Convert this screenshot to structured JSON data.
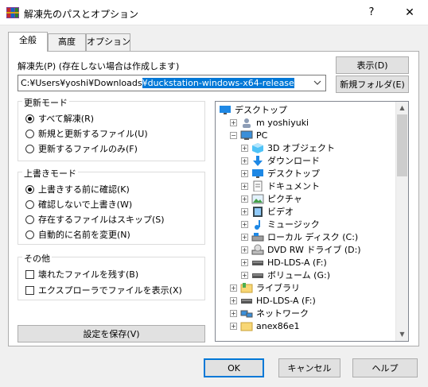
{
  "window": {
    "title": "解凍先のパスとオプション",
    "help": "?",
    "close": "✕"
  },
  "tabs": [
    "全般",
    "高度",
    "オプション"
  ],
  "dest": {
    "label": "解凍先(P) (存在しない場合は作成します)",
    "path_prefix": "C:¥Users¥yoshi¥Downloads",
    "path_selected": "¥duckstation-windows-x64-release"
  },
  "buttons": {
    "show": "表示(D)",
    "new_folder": "新規フォルダ(E)",
    "save": "設定を保存(V)",
    "ok": "OK",
    "cancel": "キャンセル",
    "help": "ヘルプ"
  },
  "update_mode": {
    "title": "更新モード",
    "options": [
      "すべて解凍(R)",
      "新規と更新するファイル(U)",
      "更新するファイルのみ(F)"
    ],
    "selected": 0
  },
  "overwrite_mode": {
    "title": "上書きモード",
    "options": [
      "上書きする前に確認(K)",
      "確認しないで上書き(W)",
      "存在するファイルはスキップ(S)",
      "自動的に名前を変更(N)"
    ],
    "selected": 0
  },
  "misc": {
    "title": "その他",
    "options": [
      "壊れたファイルを残す(B)",
      "エクスプローラでファイルを表示(X)"
    ],
    "checked": [
      false,
      false
    ]
  },
  "tree": [
    {
      "label": "デスクトップ",
      "level": 0,
      "exp": "",
      "icon": "desktop-icon"
    },
    {
      "label": "m yoshiyuki",
      "level": 1,
      "exp": "+",
      "icon": "user-icon"
    },
    {
      "label": "PC",
      "level": 1,
      "exp": "−",
      "icon": "pc-icon"
    },
    {
      "label": "3D オブジェクト",
      "level": 2,
      "exp": "+",
      "icon": "3d-objects-icon"
    },
    {
      "label": "ダウンロード",
      "level": 2,
      "exp": "+",
      "icon": "download-icon"
    },
    {
      "label": "デスクトップ",
      "level": 2,
      "exp": "+",
      "icon": "desktop-icon"
    },
    {
      "label": "ドキュメント",
      "level": 2,
      "exp": "+",
      "icon": "document-icon"
    },
    {
      "label": "ピクチャ",
      "level": 2,
      "exp": "+",
      "icon": "pictures-icon"
    },
    {
      "label": "ビデオ",
      "level": 2,
      "exp": "+",
      "icon": "video-icon"
    },
    {
      "label": "ミュージック",
      "level": 2,
      "exp": "+",
      "icon": "music-icon"
    },
    {
      "label": "ローカル ディスク (C:)",
      "level": 2,
      "exp": "+",
      "icon": "local-disk-icon"
    },
    {
      "label": "DVD RW ドライブ (D:)",
      "level": 2,
      "exp": "+",
      "icon": "dvd-drive-icon"
    },
    {
      "label": "HD-LDS-A (F:)",
      "level": 2,
      "exp": "+",
      "icon": "drive-icon"
    },
    {
      "label": "ボリューム (G:)",
      "level": 2,
      "exp": "+",
      "icon": "drive-icon"
    },
    {
      "label": "ライブラリ",
      "level": 1,
      "exp": "+",
      "icon": "library-icon"
    },
    {
      "label": "HD-LDS-A (F:)",
      "level": 1,
      "exp": "+",
      "icon": "drive-icon"
    },
    {
      "label": "ネットワーク",
      "level": 1,
      "exp": "+",
      "icon": "network-icon"
    },
    {
      "label": "anex86e1",
      "level": 1,
      "exp": "+",
      "icon": "folder-icon"
    }
  ],
  "colors": {
    "accent": "#0078d7",
    "folder": "#f8d775"
  }
}
